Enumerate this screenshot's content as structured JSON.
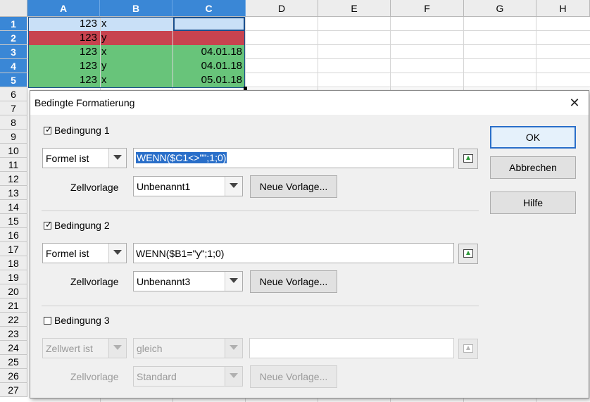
{
  "sheet": {
    "columns": [
      "A",
      "B",
      "C",
      "D",
      "E",
      "F",
      "G",
      "H"
    ],
    "rows": [
      "1",
      "2",
      "3",
      "4",
      "5",
      "6",
      "7",
      "8",
      "9",
      "10",
      "11",
      "12",
      "13",
      "14",
      "15",
      "16",
      "17",
      "18",
      "19",
      "20",
      "21",
      "22",
      "23",
      "24",
      "25",
      "26",
      "27"
    ],
    "cells": {
      "A1": "123",
      "B1": "x",
      "C1": "",
      "A2": "123",
      "B2": "y",
      "C2": "",
      "A3": "123",
      "B3": "x",
      "C3": "04.01.18",
      "A4": "123",
      "B4": "y",
      "C4": "04.01.18",
      "A5": "123",
      "B5": "x",
      "C5": "05.01.18"
    },
    "colors": {
      "selection": "#c9e0f7",
      "condition_red": "#c8434f",
      "condition_green": "#68c47a",
      "header_selected": "#3a87d6"
    }
  },
  "dialog": {
    "title": "Bedingte Formatierung",
    "close_icon": "close-icon",
    "conditions": [
      {
        "label": "Bedingung 1",
        "checked": true,
        "type": "Formel ist",
        "formula": "WENN($C1<>\"\";1;0)",
        "style_label": "Zellvorlage",
        "style": "Unbenannt1",
        "new_style_button": "Neue Vorlage..."
      },
      {
        "label": "Bedingung 2",
        "checked": true,
        "type": "Formel ist",
        "formula": "WENN($B1=\"y\";1;0)",
        "style_label": "Zellvorlage",
        "style": "Unbenannt3",
        "new_style_button": "Neue Vorlage..."
      },
      {
        "label": "Bedingung 3",
        "checked": false,
        "type": "Zellwert ist",
        "operator": "gleich",
        "value": "",
        "style_label": "Zellvorlage",
        "style": "Standard",
        "new_style_button": "Neue Vorlage..."
      }
    ],
    "buttons": {
      "ok": "OK",
      "cancel": "Abbrechen",
      "help": "Hilfe"
    },
    "picker_icon": "shrink-pick-icon",
    "check_mark": "✓"
  }
}
